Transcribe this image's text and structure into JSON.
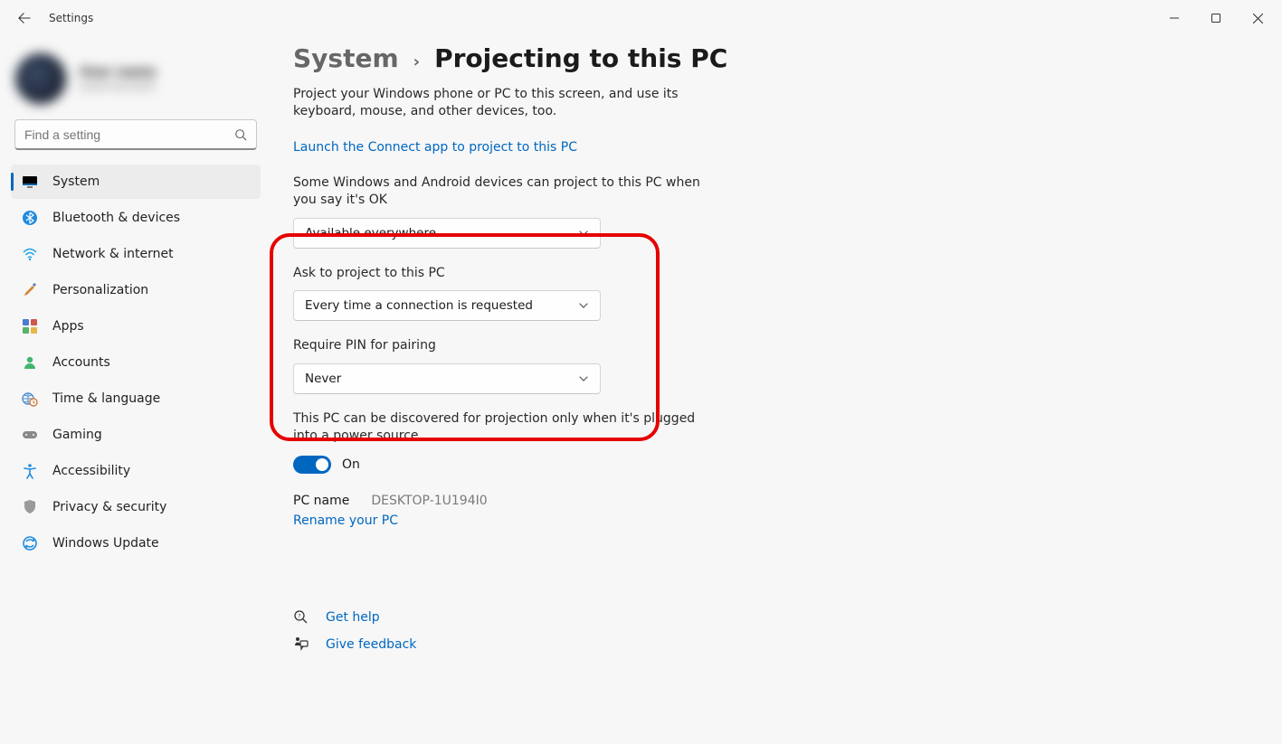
{
  "app": {
    "title": "Settings"
  },
  "profile": {
    "name": "User name",
    "sub": "Local Account"
  },
  "search": {
    "placeholder": "Find a setting"
  },
  "nav": {
    "items": [
      {
        "label": "System"
      },
      {
        "label": "Bluetooth & devices"
      },
      {
        "label": "Network & internet"
      },
      {
        "label": "Personalization"
      },
      {
        "label": "Apps"
      },
      {
        "label": "Accounts"
      },
      {
        "label": "Time & language"
      },
      {
        "label": "Gaming"
      },
      {
        "label": "Accessibility"
      },
      {
        "label": "Privacy & security"
      },
      {
        "label": "Windows Update"
      }
    ]
  },
  "breadcrumb": {
    "system": "System",
    "page": "Projecting to this PC"
  },
  "body": {
    "description": "Project your Windows phone or PC to this screen, and use its keyboard, mouse, and other devices, too.",
    "launch_link": "Launch the Connect app to project to this PC",
    "availability_label": "Some Windows and Android devices can project to this PC when you say it's OK",
    "availability_value": "Available everywhere",
    "ask_label": "Ask to project to this PC",
    "ask_value": "Every time a connection is requested",
    "pin_label": "Require PIN for pairing",
    "pin_value": "Never",
    "discover_label": "This PC can be discovered for projection only when it's plugged into a power source",
    "toggle_state": "On",
    "pcname_label": "PC name",
    "pcname_value": "DESKTOP-1U194I0",
    "rename_link": "Rename your PC"
  },
  "footer": {
    "help": "Get help",
    "feedback": "Give feedback"
  }
}
